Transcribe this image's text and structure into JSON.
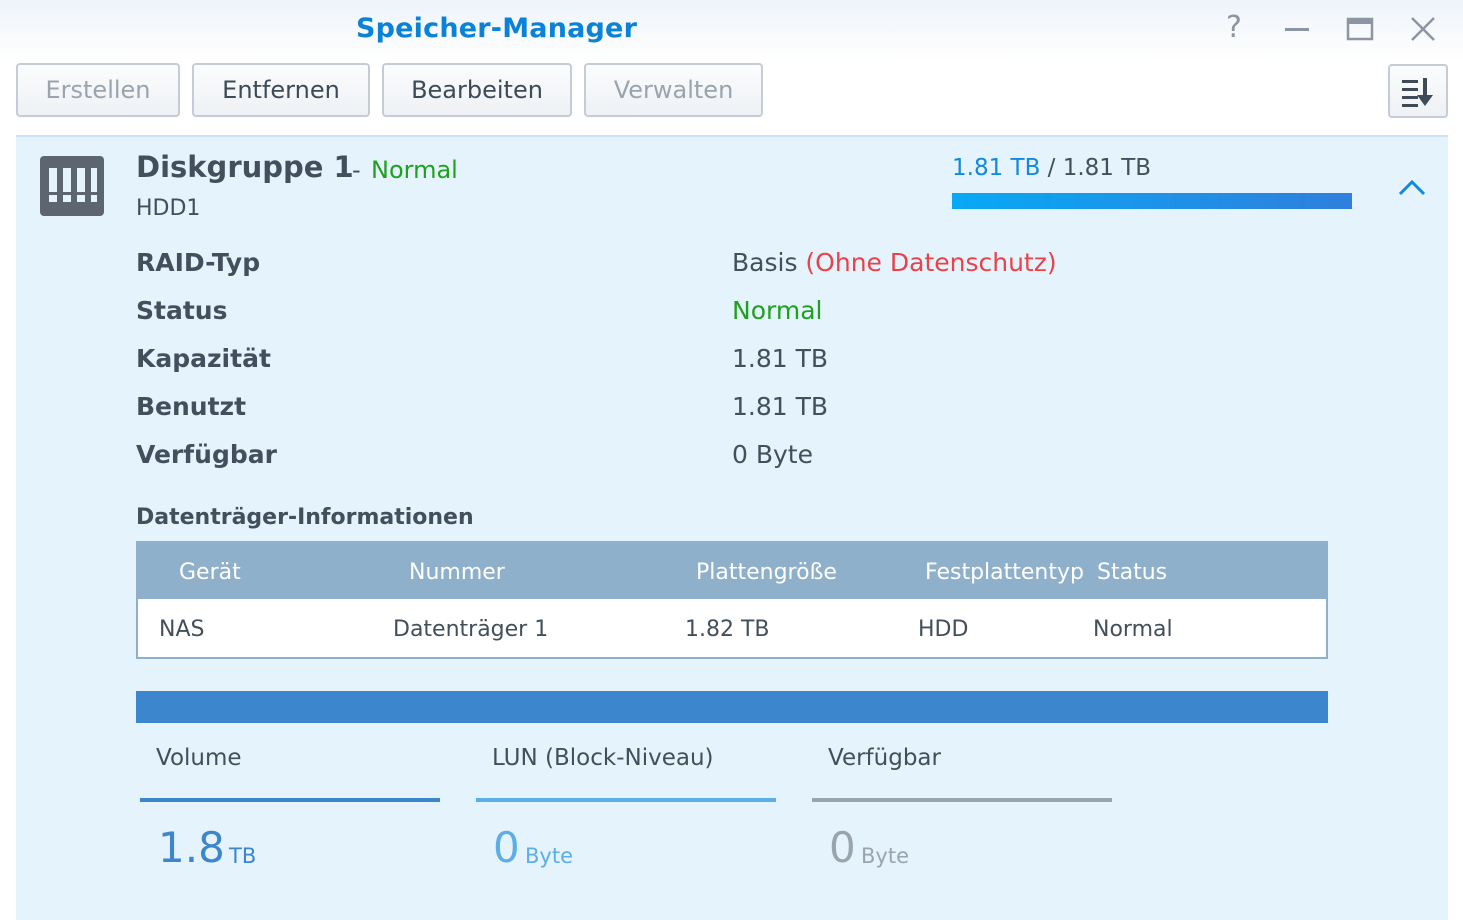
{
  "window": {
    "title": "Speicher-Manager",
    "help_glyph": "?"
  },
  "toolbar": {
    "create_label": "Erstellen",
    "remove_label": "Entfernen",
    "edit_label": "Bearbeiten",
    "manage_label": "Verwalten"
  },
  "diskgroup": {
    "name": "Diskgruppe 1",
    "dash": "-",
    "status": "Normal",
    "subtitle": "HDD1",
    "capacity_used": "1.81 TB",
    "capacity_sep": " / ",
    "capacity_total": "1.81 TB",
    "capacity_fraction": 1.0,
    "colors": {
      "bar_start": "#09a8f5",
      "bar_end": "#2f7fdc",
      "normal": "#1fa01f",
      "warning": "#e9424b"
    }
  },
  "details": [
    {
      "label": "RAID-Typ",
      "value": "Basis",
      "note": "(Ohne Datenschutz)"
    },
    {
      "label": "Status",
      "value": "Normal"
    },
    {
      "label": "Kapazität",
      "value": "1.81 TB"
    },
    {
      "label": "Benutzt",
      "value": "1.81 TB"
    },
    {
      "label": "Verfügbar",
      "value": "0 Byte"
    }
  ],
  "disk_info": {
    "title": "Datenträger-Informationen",
    "columns": [
      "Gerät",
      "Nummer",
      "Plattengröße",
      "Festplattentyp",
      "Status"
    ],
    "rows": [
      [
        "NAS",
        "Datenträger 1",
        "1.82 TB",
        "HDD",
        "Normal"
      ]
    ]
  },
  "usage": {
    "bar_color": "#3b86cc",
    "items": [
      {
        "label": "Volume",
        "value": "1.8",
        "unit": "TB",
        "color": "#3b86cc"
      },
      {
        "label": "LUN (Block-Niveau)",
        "value": "0",
        "unit": "Byte",
        "color": "#5caee8"
      },
      {
        "label": "Verfügbar",
        "value": "0",
        "unit": "Byte",
        "color": "#9aa4ae"
      }
    ]
  }
}
